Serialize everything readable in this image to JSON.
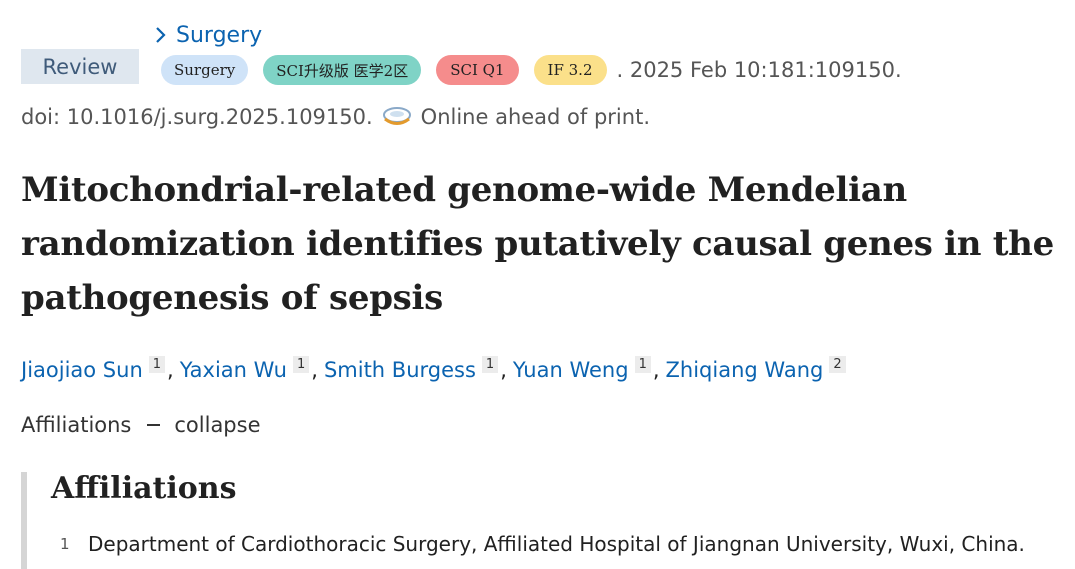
{
  "journal_link": {
    "label": "Surgery"
  },
  "article_type": "Review",
  "badges": [
    {
      "label": "Surgery",
      "color": "#cfe3f8"
    },
    {
      "label": "SCI升级版 医学2区",
      "color": "#7fd3c6"
    },
    {
      "label": "SCI Q1",
      "color": "#f58c8c"
    },
    {
      "label": "IF 3.2",
      "color": "#fbe08a"
    }
  ],
  "citation": ". 2025 Feb 10:181:109150.",
  "doi": "doi: 10.1016/j.surg.2025.109150.",
  "status": "Online ahead of print.",
  "title": "Mitochondrial-related genome-wide Mendelian randomization identifies putatively causal genes in the pathogenesis of sepsis",
  "authors": [
    {
      "name": "Jiaojiao Sun",
      "aff": "1"
    },
    {
      "name": "Yaxian Wu",
      "aff": "1"
    },
    {
      "name": "Smith Burgess",
      "aff": "1"
    },
    {
      "name": "Yuan Weng",
      "aff": "1"
    },
    {
      "name": "Zhiqiang Wang",
      "aff": "2"
    }
  ],
  "author_separator": ",",
  "affiliations_toggle": {
    "label": "Affiliations",
    "action": "collapse"
  },
  "affiliations_section": {
    "heading": "Affiliations",
    "items": [
      {
        "num": "1",
        "text": "Department of Cardiothoracic Surgery, Affiliated Hospital of Jiangnan University, Wuxi, China."
      }
    ]
  },
  "colors": {
    "link": "#0b63b0",
    "review_bg": "#dfe7ef",
    "review_text": "#3f5b7a"
  }
}
